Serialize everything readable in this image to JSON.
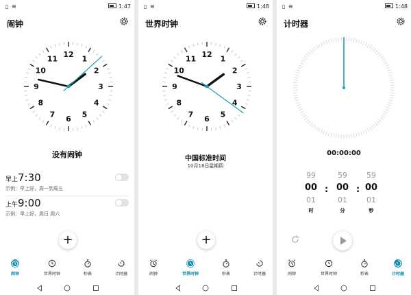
{
  "colors": {
    "accent": "#0b8bb0",
    "second_hand": "#14a0b4"
  },
  "screens": [
    {
      "status_time": "1:47",
      "title": "闹钟",
      "clock_numbers": [
        "12",
        "1",
        "2",
        "3",
        "4",
        "5",
        "6",
        "7",
        "8",
        "9",
        "10",
        "11"
      ],
      "status_label": "没有闹钟",
      "alarms": [
        {
          "prefix": "早上",
          "time": "7:30",
          "note": "示例：早上好，周一到周五",
          "enabled": false
        },
        {
          "prefix": "上午",
          "time": "9:00",
          "note": "示例：早上好，周日 周六",
          "enabled": false
        }
      ],
      "fab_icon": "add-icon",
      "active_tab": 0
    },
    {
      "status_time": "1:48",
      "title": "世界时钟",
      "clock_numbers": [
        "12",
        "1",
        "2",
        "3",
        "4",
        "5",
        "6",
        "7",
        "8",
        "9",
        "10",
        "11"
      ],
      "zone_name": "中国标准时间",
      "zone_date": "10月18日星期四",
      "fab_icon": "add-icon",
      "active_tab": 1
    },
    {
      "status_time": "1:48",
      "title": "计时器",
      "timer_display": "00:00:00",
      "pickers": [
        {
          "prev": "99",
          "current": "00",
          "next": "01",
          "unit": "时"
        },
        {
          "prev": "59",
          "current": "00",
          "next": "01",
          "unit": "分"
        },
        {
          "prev": "59",
          "current": "00",
          "next": "01",
          "unit": "秒"
        }
      ],
      "colon": ":",
      "active_tab": 3
    }
  ],
  "tabs": [
    {
      "label": "闹钟",
      "icon": "alarm-clock-icon"
    },
    {
      "label": "世界时钟",
      "icon": "world-clock-icon"
    },
    {
      "label": "秒表",
      "icon": "stopwatch-icon"
    },
    {
      "label": "计时器",
      "icon": "timer-icon"
    }
  ],
  "nav_icons": [
    "back-icon",
    "home-icon",
    "recents-icon"
  ]
}
